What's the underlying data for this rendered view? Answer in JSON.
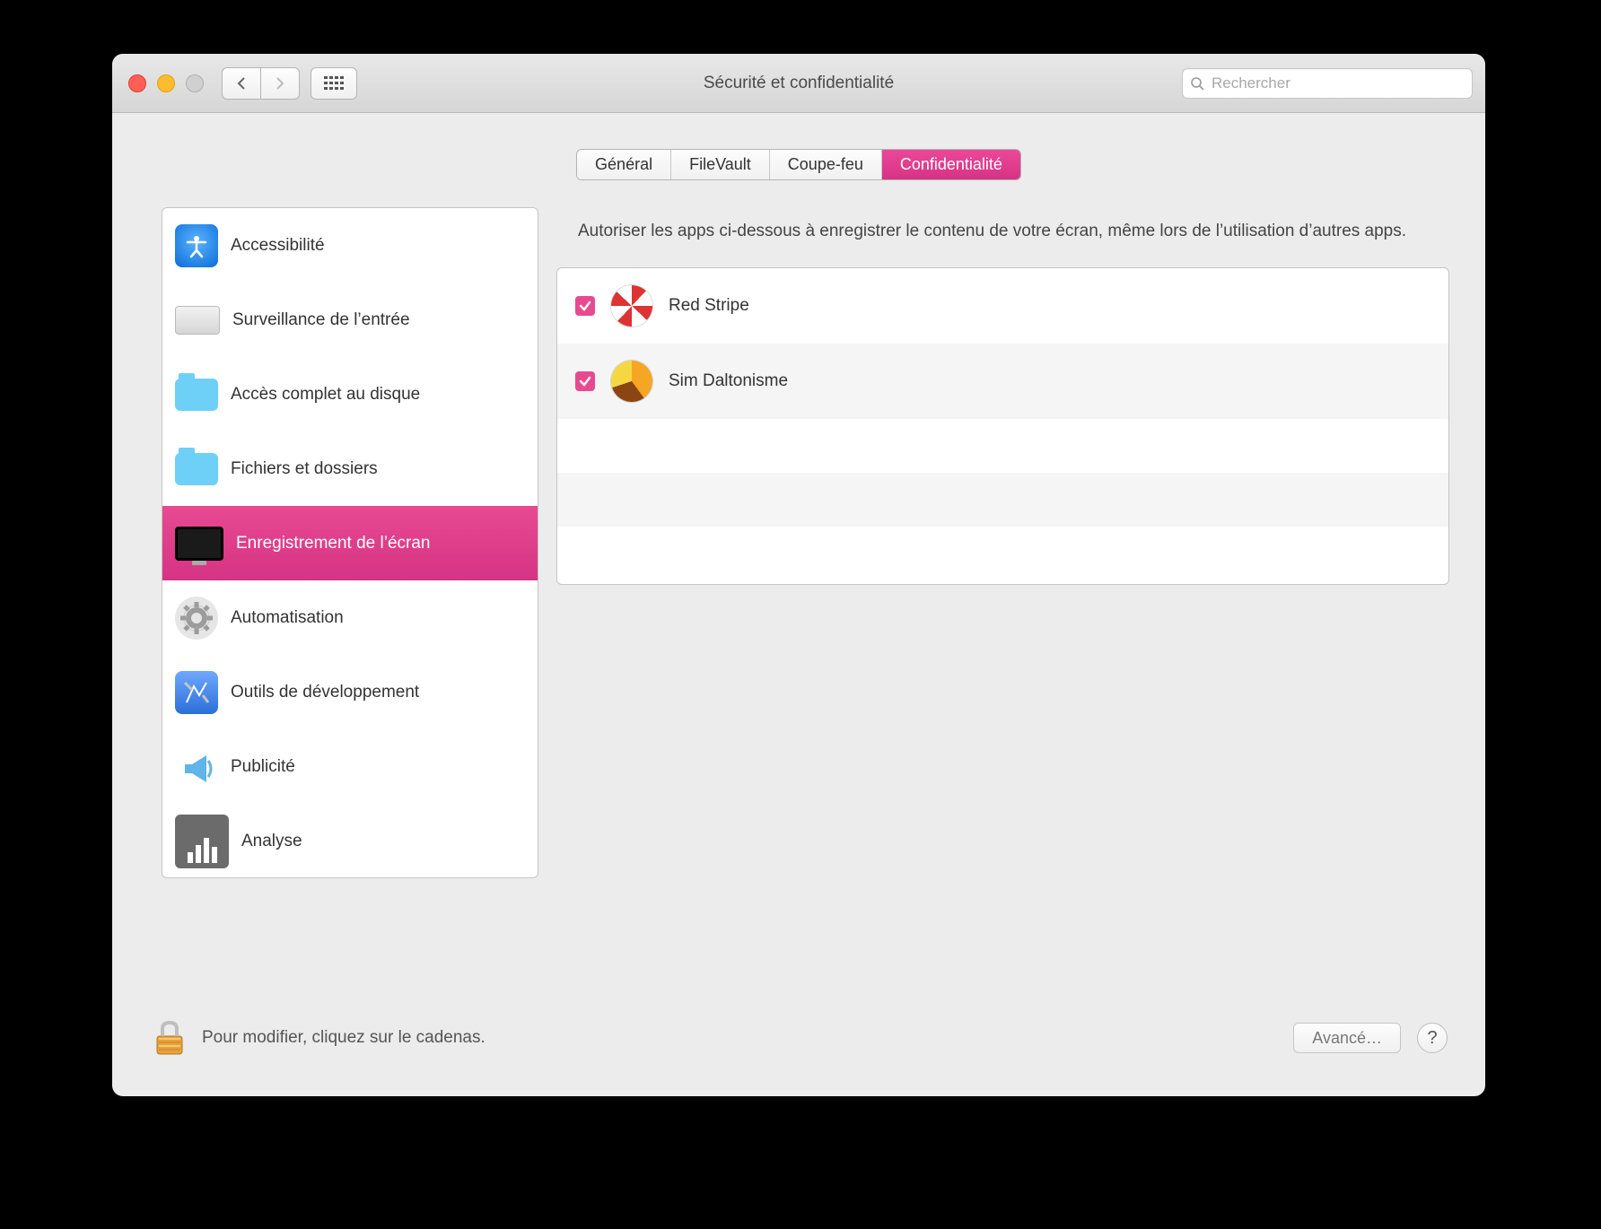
{
  "colors": {
    "accent": "#e84a92"
  },
  "titlebar": {
    "title": "Sécurité et confidentialité",
    "search_placeholder": "Rechercher"
  },
  "tabs": [
    {
      "label": "Général",
      "active": false
    },
    {
      "label": "FileVault",
      "active": false
    },
    {
      "label": "Coupe-feu",
      "active": false
    },
    {
      "label": "Confidentialité",
      "active": true
    }
  ],
  "sidebar": {
    "items": [
      {
        "label": "Accessibilité",
        "icon": "accessibility-icon",
        "selected": false
      },
      {
        "label": "Surveillance de l’entrée",
        "icon": "keyboard-icon",
        "selected": false
      },
      {
        "label": "Accès complet au disque",
        "icon": "folder-icon",
        "selected": false
      },
      {
        "label": "Fichiers et dossiers",
        "icon": "folder-icon",
        "selected": false
      },
      {
        "label": "Enregistrement de l’écran",
        "icon": "monitor-icon",
        "selected": true
      },
      {
        "label": "Automatisation",
        "icon": "gear-icon",
        "selected": false
      },
      {
        "label": "Outils de développement",
        "icon": "developer-tools-icon",
        "selected": false
      },
      {
        "label": "Publicité",
        "icon": "megaphone-icon",
        "selected": false
      },
      {
        "label": "Analyse",
        "icon": "analytics-icon",
        "selected": false
      }
    ]
  },
  "pane": {
    "description": "Autoriser les apps ci-dessous à enregistrer le contenu de votre écran, même lors de l’utilisation d’autres apps.",
    "apps": [
      {
        "label": "Red Stripe",
        "checked": true,
        "icon": "red-stripe"
      },
      {
        "label": "Sim Daltonisme",
        "checked": true,
        "icon": "sim-dalton"
      }
    ]
  },
  "footer": {
    "lock_text": "Pour modifier, cliquez sur le cadenas.",
    "advanced_label": "Avancé…"
  }
}
